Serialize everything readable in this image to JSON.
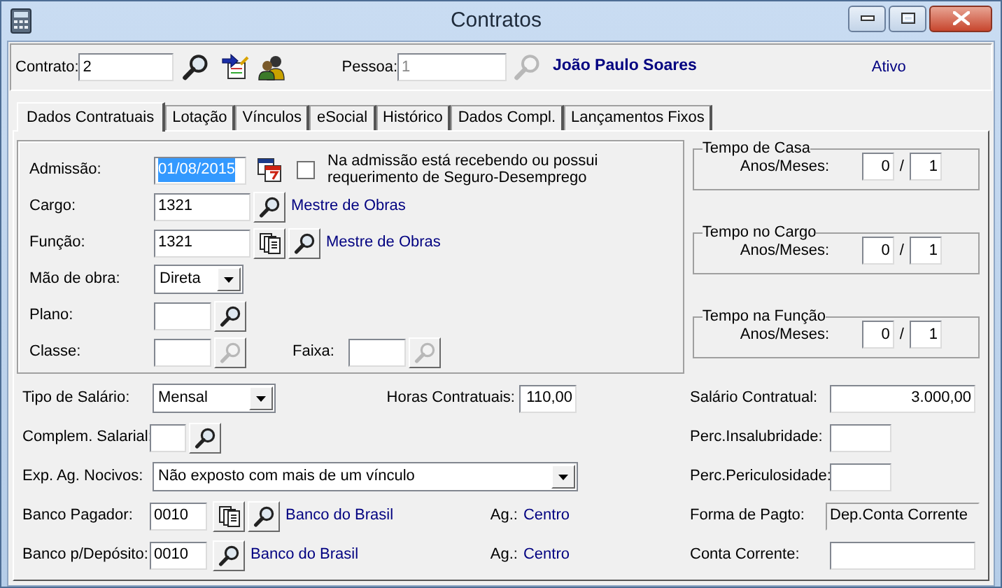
{
  "window": {
    "title": "Contratos"
  },
  "header": {
    "contract_label": "Contrato:",
    "contract": "2",
    "person_label": "Pessoa:",
    "person": "1",
    "person_disabled": true,
    "person_name": "João Paulo Soares",
    "status": "Ativo"
  },
  "tabs": [
    {
      "label": "Dados Contratuais",
      "selected": true
    },
    {
      "label": "Lotação",
      "selected": false
    },
    {
      "label": "Vínculos",
      "selected": false
    },
    {
      "label": "eSocial",
      "selected": false
    },
    {
      "label": "Histórico",
      "selected": false
    },
    {
      "label": "Dados Compl.",
      "selected": false
    },
    {
      "label": "Lançamentos Fixos",
      "selected": false
    }
  ],
  "admission": {
    "label": "Admissão:",
    "value": "01/08/2015",
    "value_selected": true
  },
  "unemployment_check": {
    "label": "Na admissão está recebendo ou possui requerimento de Seguro-Desemprego",
    "checked": false
  },
  "cargo": {
    "label": "Cargo:",
    "code": "1321",
    "name": "Mestre de Obras"
  },
  "funcao": {
    "label": "Função:",
    "code": "1321",
    "name": "Mestre de Obras"
  },
  "mao_de_obra": {
    "label": "Mão de obra:",
    "value": "Direta"
  },
  "plano": {
    "label": "Plano:",
    "lookup_disabled": false
  },
  "classe": {
    "label": "Classe:",
    "lookup_disabled": true
  },
  "faixa": {
    "label": "Faixa:",
    "lookup_disabled": true
  },
  "tenure_groups": [
    {
      "title": "Tempo de Casa",
      "label": "Anos/Meses:",
      "years": "0",
      "separator": "/",
      "months": "1"
    },
    {
      "title": "Tempo no Cargo",
      "label": "Anos/Meses:",
      "years": "0",
      "separator": "/",
      "months": "1"
    },
    {
      "title": "Tempo na Função",
      "label": "Anos/Meses:",
      "years": "0",
      "separator": "/",
      "months": "1"
    }
  ],
  "tipo_salario": {
    "label": "Tipo de Salário:",
    "value": "Mensal"
  },
  "horas": {
    "label": "Horas Contratuais:",
    "value": "110,00"
  },
  "salario": {
    "label": "Salário Contratual:",
    "value": "3.000,00"
  },
  "complem": {
    "label": "Complem. Salarial:"
  },
  "insalubridade": {
    "label": "Perc.Insalubridade:"
  },
  "nocivos": {
    "label": "Exp. Ag. Nocivos:",
    "value": "Não exposto com mais de um vínculo"
  },
  "periculosidade": {
    "label": "Perc.Periculosidade:"
  },
  "banco_pagador": {
    "label": "Banco Pagador:",
    "code": "0010",
    "name": "Banco do Brasil",
    "agency_label": "Ag.:",
    "agency": "Centro"
  },
  "banco_deposito": {
    "label": "Banco p/Depósito:",
    "code": "0010",
    "name": "Banco do Brasil",
    "agency_label": "Ag.:",
    "agency": "Centro"
  },
  "forma_pagto": {
    "label": "Forma de Pagto:",
    "value": "Dep.Conta Corrente"
  },
  "conta": {
    "label": "Conta Corrente:"
  }
}
